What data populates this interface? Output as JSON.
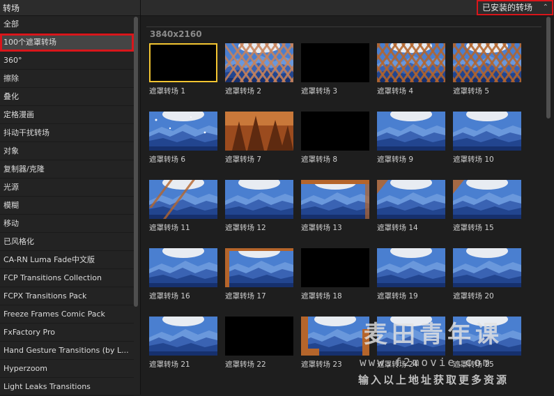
{
  "sidebar": {
    "title": "转场",
    "items": [
      {
        "label": "全部"
      },
      {
        "label": "100个遮罩转场",
        "selected": true
      },
      {
        "label": "360°"
      },
      {
        "label": "擦除"
      },
      {
        "label": "叠化"
      },
      {
        "label": "定格漫画"
      },
      {
        "label": "抖动干扰转场"
      },
      {
        "label": "对象"
      },
      {
        "label": "复制器/克隆"
      },
      {
        "label": "光源"
      },
      {
        "label": "模糊"
      },
      {
        "label": "移动"
      },
      {
        "label": "已风格化"
      },
      {
        "label": "CA-RN Luma Fade中文版"
      },
      {
        "label": "FCP Transitions Collection"
      },
      {
        "label": "FCPX Transitions Pack"
      },
      {
        "label": "Freeze Frames Comic Pack"
      },
      {
        "label": "FxFactory Pro"
      },
      {
        "label": "Hand Gesture Transitions (by L..."
      },
      {
        "label": "Hyperzoom"
      },
      {
        "label": "Light Leaks Transitions"
      }
    ]
  },
  "header": {
    "installed_label": "已安装的转场",
    "chevron_icon": "up-down-chevron-icon"
  },
  "section": {
    "heading": "3840x2160"
  },
  "tiles": [
    {
      "label": "遮罩转场 1",
      "style": "black",
      "selected": true
    },
    {
      "label": "遮罩转场 2",
      "style": "lattice"
    },
    {
      "label": "遮罩转场 3",
      "style": "black"
    },
    {
      "label": "遮罩转场 4",
      "style": "lattice-orange"
    },
    {
      "label": "遮罩转场 5",
      "style": "lattice-orange"
    },
    {
      "label": "遮罩转场 6",
      "style": "mountain-dots"
    },
    {
      "label": "遮罩转场 7",
      "style": "forest"
    },
    {
      "label": "遮罩转场 8",
      "style": "black"
    },
    {
      "label": "遮罩转场 9",
      "style": "mountain"
    },
    {
      "label": "遮罩转场 10",
      "style": "mountain"
    },
    {
      "label": "遮罩转场 11",
      "style": "mountain-streaks"
    },
    {
      "label": "遮罩转场 12",
      "style": "mountain"
    },
    {
      "label": "遮罩转场 13",
      "style": "mountain-edge"
    },
    {
      "label": "遮罩转场 14",
      "style": "mountain-corner"
    },
    {
      "label": "遮罩转场 15",
      "style": "mountain-corner"
    },
    {
      "label": "遮罩转场 16",
      "style": "mountain"
    },
    {
      "label": "遮罩转场 17",
      "style": "mountain-frame"
    },
    {
      "label": "遮罩转场 18",
      "style": "black"
    },
    {
      "label": "遮罩转场 19",
      "style": "mountain"
    },
    {
      "label": "遮罩转场 20",
      "style": "mountain"
    },
    {
      "label": "遮罩转场 21",
      "style": "mountain"
    },
    {
      "label": "遮罩转场 22",
      "style": "black"
    },
    {
      "label": "遮罩转场 23",
      "style": "mountain-blocks"
    },
    {
      "label": "遮罩转场 24",
      "style": "mountain"
    },
    {
      "label": "遮罩转场 25",
      "style": "mountain"
    }
  ],
  "watermark": {
    "brand": "麦田青年课",
    "url": "www.f2movie.com",
    "note": "输入以上地址获取更多资源"
  },
  "colors": {
    "accent_red": "#d9161b",
    "selection_yellow": "#f3c531",
    "sky": "#3d6fc4",
    "mountain_dark": "#1d3a7e",
    "copper": "#b5652b"
  }
}
